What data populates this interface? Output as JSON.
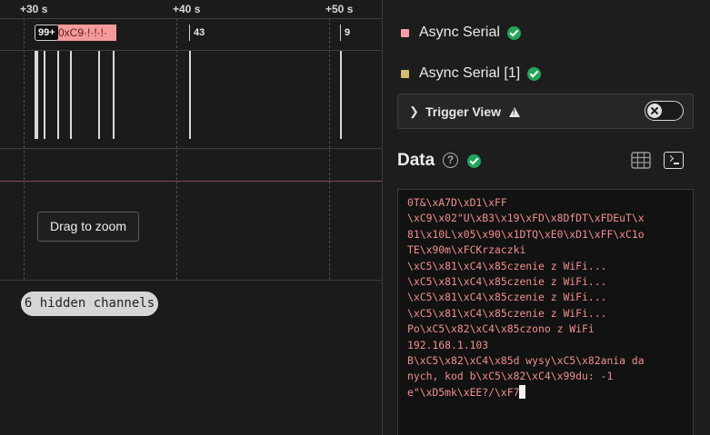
{
  "timeline": {
    "ticks": [
      "+30 s",
      "+40 s",
      "+50 s"
    ],
    "packet_count_badge": "99+",
    "byte_badge": "0xC9·!·!·!·",
    "marker_a": "43",
    "marker_b": "9",
    "zoom_button": "Drag to zoom",
    "hidden_channels": "6 hidden channels"
  },
  "colors": {
    "async_serial": "#f4a0a0",
    "async_serial_1": "#d5bb74",
    "status_ok": "#23a55a",
    "terminal_text": "#f08f8f"
  },
  "analyzers": [
    {
      "name": "Async Serial",
      "status_icon": "check-circle-icon"
    },
    {
      "name": "Async Serial [1]",
      "status_icon": "check-circle-icon"
    }
  ],
  "trigger_view": {
    "label": "Trigger View",
    "enabled": false
  },
  "data_panel": {
    "title": "Data",
    "help_glyph": "?",
    "lines": [
      "0T&\\xA7D\\xD1\\xFF",
      "\\xC9\\x02\"U\\xB3\\x19\\xFD\\x8DfDT\\xFDEuT\\x",
      "81\\x10L\\x05\\x90\\x1DTQ\\xE0\\xD1\\xFF\\xC1o",
      "TE\\x90m\\xFCKrzaczki",
      "\\xC5\\x81\\xC4\\x85czenie z WiFi...",
      "\\xC5\\x81\\xC4\\x85czenie z WiFi...",
      "\\xC5\\x81\\xC4\\x85czenie z WiFi...",
      "\\xC5\\x81\\xC4\\x85czenie z WiFi...",
      "Po\\xC5\\x82\\xC4\\x85czono z WiFi",
      "192.168.1.103",
      "B\\xC5\\x82\\xC4\\x85d wysy\\xC5\\x82ania da",
      "nych, kod b\\xC5\\x82\\xC4\\x99du: -1"
    ],
    "last_line": "e\"\\xD5mk\\xEE?/\\xF7"
  }
}
